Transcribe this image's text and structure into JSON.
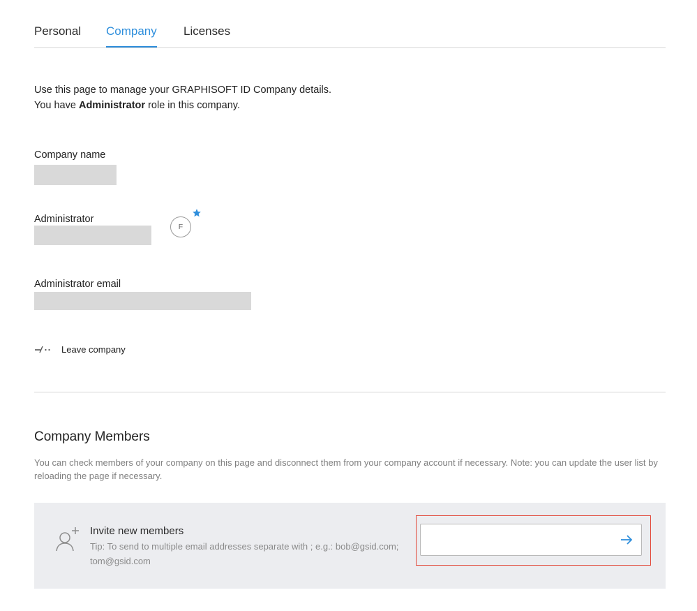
{
  "tabs": [
    {
      "label": "Personal",
      "active": false
    },
    {
      "label": "Company",
      "active": true
    },
    {
      "label": "Licenses",
      "active": false
    }
  ],
  "intro": {
    "line1": "Use this page to manage your GRAPHISOFT ID Company details.",
    "line2_prefix": "You have ",
    "line2_role": "Administrator",
    "line2_suffix": " role in this company."
  },
  "fields": {
    "company_name_label": "Company name",
    "administrator_label": "Administrator",
    "administrator_email_label": "Administrator email"
  },
  "avatar": {
    "initial": "F",
    "star_icon": "star-icon",
    "accent": "#2f8fdc"
  },
  "leave": {
    "label": "Leave company",
    "icon": "disconnect-icon"
  },
  "members": {
    "title": "Company Members",
    "description": "You can check members of your company on this page and disconnect them from your company account if necessary. Note: you can update the user list by reloading the page if necessary."
  },
  "invite": {
    "title": "Invite new members",
    "tip": "Tip: To send to multiple email addresses separate with ; e.g.: bob@gsid.com; tom@gsid.com",
    "input_value": "",
    "icon": "add-user-icon",
    "send_icon": "arrow-right-icon",
    "highlight_color": "#e2493a"
  },
  "colors": {
    "accent": "#2f8fdc",
    "panel_background": "#ecedf0",
    "redacted": "#d9d9d9"
  }
}
